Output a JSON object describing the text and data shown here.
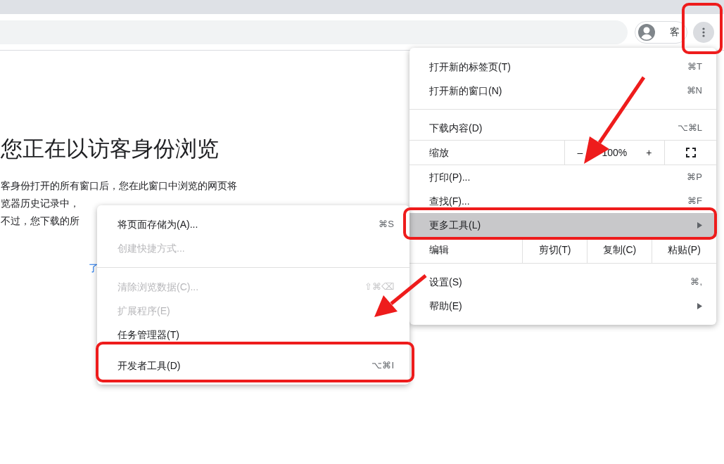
{
  "toolbar": {
    "profile_label": "客"
  },
  "page": {
    "heading": "您正在以访客身份浏览",
    "lines": [
      "客身份打开的所有窗口后，您在此窗口中浏览的网页将",
      "览器历史记录中，",
      "不过，您下载的所"
    ],
    "link": "了"
  },
  "menu": {
    "items": [
      {
        "kind": "item",
        "label": "打开新的标签页(T)",
        "shortcut": "⌘T",
        "selected": false,
        "has_submenu": false
      },
      {
        "kind": "item",
        "label": "打开新的窗口(N)",
        "shortcut": "⌘N",
        "selected": false,
        "has_submenu": false
      },
      {
        "kind": "separator"
      },
      {
        "kind": "item",
        "label": "下载内容(D)",
        "shortcut": "⌥⌘L",
        "selected": false,
        "has_submenu": false
      },
      {
        "kind": "zoom",
        "label": "缩放",
        "minus": "–",
        "value": "100%",
        "plus": "+"
      },
      {
        "kind": "item",
        "label": "打印(P)...",
        "shortcut": "⌘P",
        "selected": false,
        "has_submenu": false
      },
      {
        "kind": "item",
        "label": "查找(F)...",
        "shortcut": "⌘F",
        "selected": false,
        "has_submenu": false
      },
      {
        "kind": "item",
        "label": "更多工具(L)",
        "selected": true,
        "has_submenu": true
      },
      {
        "kind": "edit",
        "label": "编辑",
        "actions": [
          "剪切(T)",
          "复制(C)",
          "粘贴(P)"
        ]
      },
      {
        "kind": "item",
        "label": "设置(S)",
        "shortcut": "⌘,",
        "selected": false,
        "has_submenu": false
      },
      {
        "kind": "item",
        "label": "帮助(E)",
        "selected": false,
        "has_submenu": true
      }
    ]
  },
  "submenu": {
    "items": [
      {
        "kind": "item",
        "label": "将页面存储为(A)...",
        "shortcut": "⌘S",
        "disabled": false
      },
      {
        "kind": "item",
        "label": "创建快捷方式...",
        "disabled": true
      },
      {
        "kind": "separator"
      },
      {
        "kind": "item",
        "label": "清除浏览数据(C)...",
        "shortcut": "⇧⌘⌫",
        "disabled": true
      },
      {
        "kind": "item",
        "label": "扩展程序(E)",
        "disabled": true
      },
      {
        "kind": "item",
        "label": "任务管理器(T)",
        "disabled": false
      },
      {
        "kind": "item",
        "label": "开发者工具(D)",
        "shortcut": "⌥⌘I",
        "disabled": false
      }
    ]
  }
}
